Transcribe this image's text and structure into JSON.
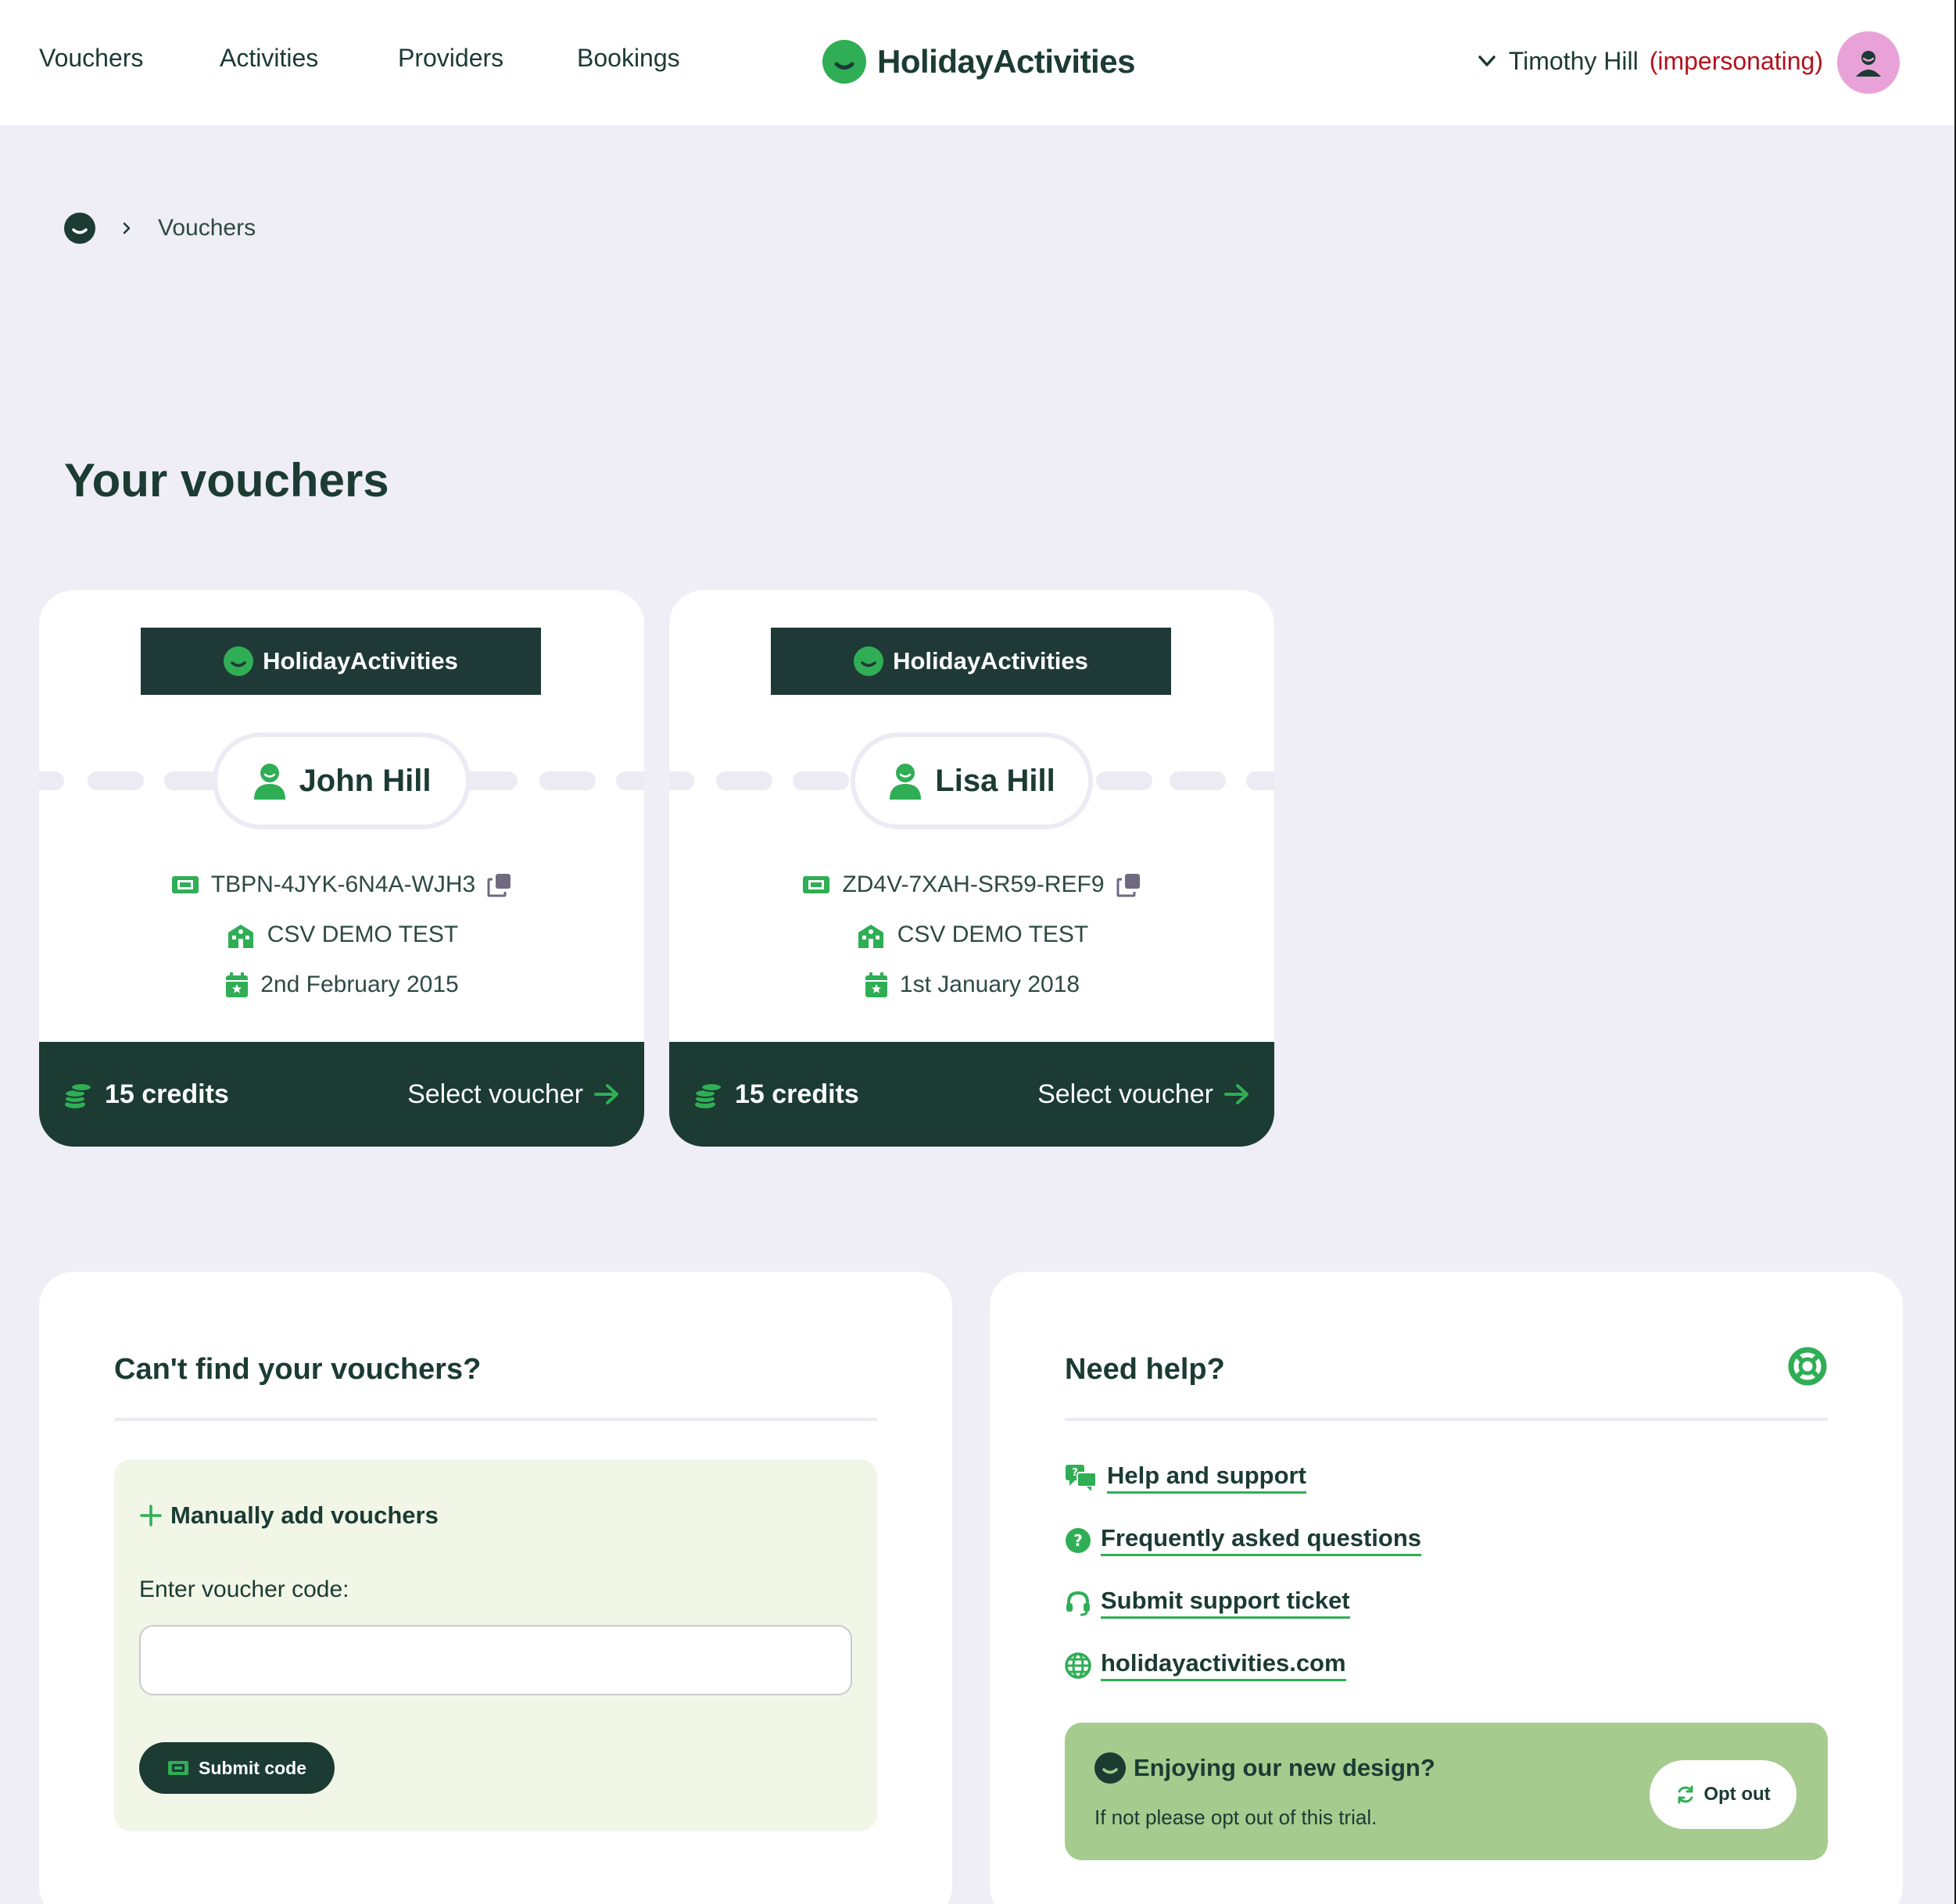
{
  "nav": {
    "items": [
      {
        "label": "Vouchers"
      },
      {
        "label": "Activities"
      },
      {
        "label": "Providers"
      },
      {
        "label": "Bookings"
      }
    ],
    "brand": "HolidayActivities",
    "user_name": "Timothy Hill",
    "user_status": "(impersonating)"
  },
  "breadcrumb": {
    "current": "Vouchers"
  },
  "page": {
    "title": "Your vouchers"
  },
  "vouchers": [
    {
      "brand": "HolidayActivities",
      "name": "John Hill",
      "code": "TBPN-4JYK-6N4A-WJH3",
      "organisation": "CSV DEMO TEST",
      "date": "2nd February 2015",
      "credits": "15 credits",
      "action": "Select voucher"
    },
    {
      "brand": "HolidayActivities",
      "name": "Lisa Hill",
      "code": "ZD4V-7XAH-SR59-REF9",
      "organisation": "CSV DEMO TEST",
      "date": "1st January 2018",
      "credits": "15 credits",
      "action": "Select voucher"
    }
  ],
  "find_panel": {
    "title": "Can't find your vouchers?",
    "manual_label": "Manually add vouchers",
    "field_label": "Enter voucher code:",
    "input_value": "",
    "submit_label": "Submit code"
  },
  "help_panel": {
    "title": "Need help?",
    "links": [
      {
        "label": "Help and support",
        "icon": "chat-bubbles-icon"
      },
      {
        "label": "Frequently asked questions",
        "icon": "question-circle-icon"
      },
      {
        "label": "Submit support ticket",
        "icon": "headset-icon"
      },
      {
        "label": "holidayactivities.com",
        "icon": "globe-icon"
      }
    ],
    "design_title": "Enjoying our new design?",
    "design_sub": "If not please opt out of this trial.",
    "optout_label": "Opt out"
  },
  "colors": {
    "brand_green": "#2fae55",
    "dark_green": "#1b3b33",
    "impersonating_red": "#b3121d",
    "page_bg": "#efedf5",
    "avatar_pink": "#e9a2d8"
  }
}
